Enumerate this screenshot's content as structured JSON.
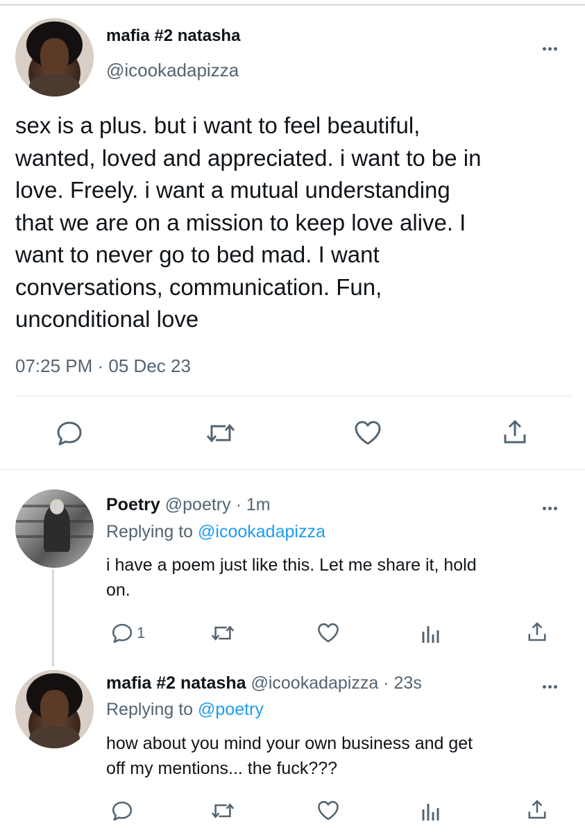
{
  "main_tweet": {
    "display_name": "mafia #2 natasha",
    "handle": "@icookadapizza",
    "text_lines": [
      "sex is a plus. but i want to feel beautiful,",
      "wanted, loved and appreciated. i want to be in",
      "love. Freely. i want a mutual understanding",
      "that we are on a mission to keep love alive. I",
      "want to never go to bed mad. I want",
      "conversations, communication. Fun,",
      "unconditional love"
    ],
    "timestamp": "07:25 PM · 05 Dec 23",
    "actions": [
      "reply-icon",
      "retweet-icon",
      "like-icon",
      "share-icon"
    ]
  },
  "reply_1": {
    "display_name": "Poetry",
    "handle": "@poetry",
    "time": "· 1m",
    "replying_prefix": "Replying to ",
    "replying_to": "@icookadapizza",
    "text_lines": [
      "i have a poem just like this. Let me share it, hold",
      "on."
    ],
    "reply_count": "1",
    "actions": [
      "reply-icon",
      "retweet-icon",
      "like-icon",
      "analytics-icon",
      "share-icon"
    ]
  },
  "reply_2": {
    "display_name": "mafia #2 natasha",
    "handle": "@icookadapizza",
    "time": "· 23s",
    "replying_prefix": "Replying to ",
    "replying_to": "@poetry",
    "text_lines": [
      "how about you mind your own business and get",
      "off my mentions... the fuck???"
    ],
    "actions": [
      "reply-icon",
      "retweet-icon",
      "like-icon",
      "analytics-icon",
      "share-icon"
    ]
  },
  "colors": {
    "text": "#0f1419",
    "muted": "#536471",
    "link": "#1d9bf0",
    "divider": "#e3e6e8"
  }
}
